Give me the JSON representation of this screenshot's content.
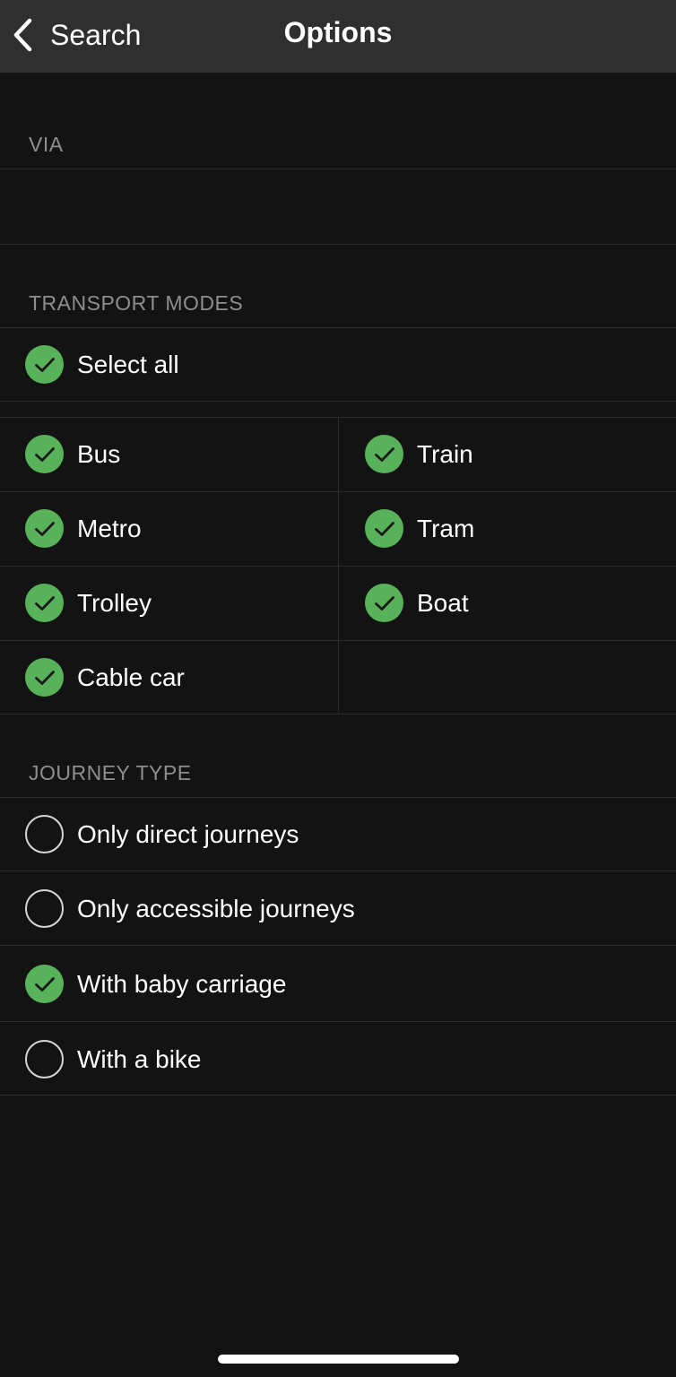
{
  "navbar": {
    "back_label": "Search",
    "title": "Options"
  },
  "via": {
    "header": "VIA",
    "value": ""
  },
  "transport_modes": {
    "header": "TRANSPORT MODES",
    "select_all": {
      "label": "Select all",
      "checked": true
    },
    "modes": [
      {
        "label": "Bus",
        "checked": true
      },
      {
        "label": "Train",
        "checked": true
      },
      {
        "label": "Metro",
        "checked": true
      },
      {
        "label": "Tram",
        "checked": true
      },
      {
        "label": "Trolley",
        "checked": true
      },
      {
        "label": "Boat",
        "checked": true
      },
      {
        "label": "Cable car",
        "checked": true
      }
    ]
  },
  "journey_type": {
    "header": "JOURNEY TYPE",
    "options": [
      {
        "label": "Only direct journeys",
        "checked": false
      },
      {
        "label": "Only accessible journeys",
        "checked": false
      },
      {
        "label": "With baby carriage",
        "checked": true
      },
      {
        "label": "With a bike",
        "checked": false
      }
    ]
  },
  "colors": {
    "background": "#131313",
    "navbar": "#2f2f2f",
    "accent_green": "#58b25a",
    "header_text": "#8e8e8e",
    "separator": "#2c2c2c"
  },
  "icons": {
    "back": "chevron-left-icon",
    "checked": "checkmark-circle-icon",
    "unchecked": "empty-circle-icon"
  }
}
